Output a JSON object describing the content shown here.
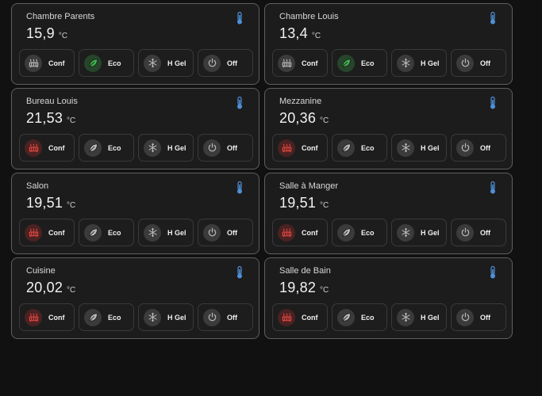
{
  "unit": "°C",
  "mode_labels": {
    "conf": "Conf",
    "eco": "Eco",
    "hgel": "H Gel",
    "off": "Off"
  },
  "colors": {
    "active_red": "#e0463f",
    "active_green": "#3fb34c",
    "inactive": "#b9b9b9",
    "thermometer": "#4f8fd6"
  },
  "rooms": [
    {
      "name": "Chambre Parents",
      "temp": "15,9",
      "active": "eco"
    },
    {
      "name": "Chambre Louis",
      "temp": "13,4",
      "active": "eco"
    },
    {
      "name": "Bureau Louis",
      "temp": "21,53",
      "active": "conf"
    },
    {
      "name": "Mezzanine",
      "temp": "20,36",
      "active": "conf"
    },
    {
      "name": "Salon",
      "temp": "19,51",
      "active": "conf"
    },
    {
      "name": "Salle à Manger",
      "temp": "19,51",
      "active": "conf"
    },
    {
      "name": "Cuisine",
      "temp": "20,02",
      "active": "conf"
    },
    {
      "name": "Salle de Bain",
      "temp": "19,82",
      "active": "conf"
    }
  ]
}
